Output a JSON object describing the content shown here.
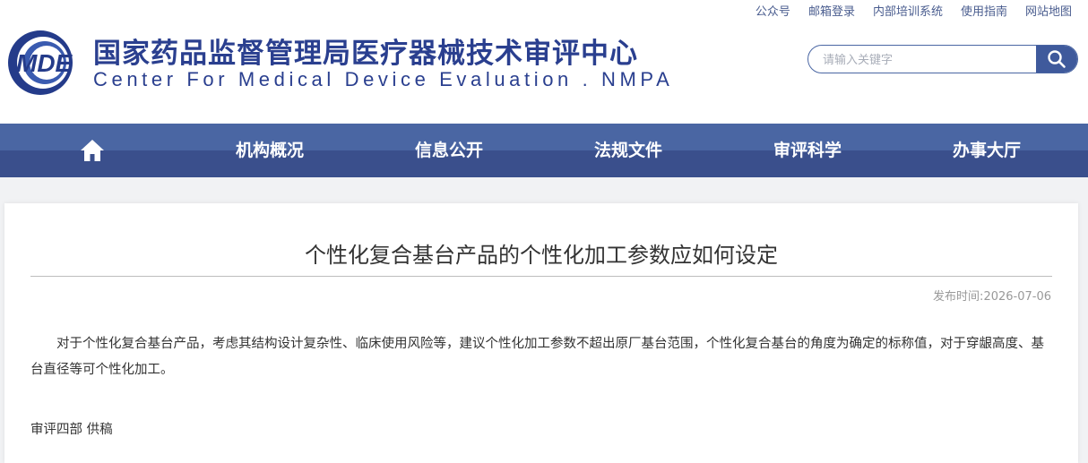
{
  "top_links": [
    "公众号",
    "邮箱登录",
    "内部培训系统",
    "使用指南",
    "网站地图"
  ],
  "logo": {
    "text": "MDE"
  },
  "site": {
    "title_cn": "国家药品监督管理局医疗器械技术审评中心",
    "title_en": "Center For Medical Device Evaluation . NMPA"
  },
  "search": {
    "placeholder": "请输入关键字",
    "value": ""
  },
  "nav": {
    "home_icon": "home-icon",
    "items": [
      "机构概况",
      "信息公开",
      "法规文件",
      "审评科学",
      "办事大厅"
    ]
  },
  "article": {
    "title": "个性化复合基台产品的个性化加工参数应如何设定",
    "pubdate_label": "发布时间:",
    "pubdate": "2026-07-06",
    "body": "对于个性化复合基台产品，考虑其结构设计复杂性、临床使用风险等，建议个性化加工参数不超出原厂基台范围，个性化复合基台的角度为确定的标称值，对于穿龈高度、基台直径等可个性化加工。",
    "signature": "审评四部 供稿"
  },
  "colors": {
    "brand_blue": "#2a3f8f",
    "nav_top": "#4a66a3",
    "nav_bottom": "#3a4f8c",
    "search_button": "#3f5a9c"
  }
}
